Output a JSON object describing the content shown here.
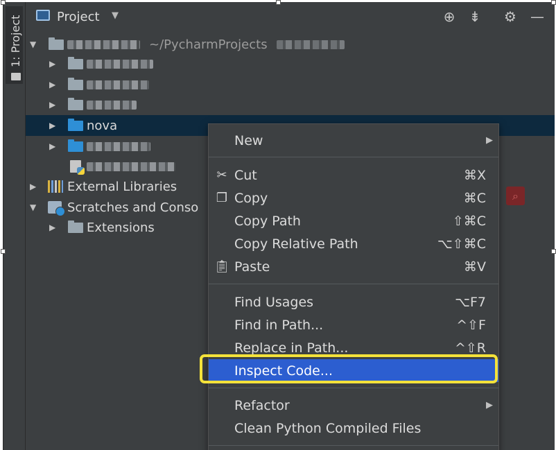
{
  "sidebar_strip": {
    "label": "1: Project",
    "icon": "folder-icon"
  },
  "header": {
    "title": "Project",
    "icons": [
      "crosshair-icon",
      "collapse-icon",
      "gear-icon",
      "minimize-icon"
    ]
  },
  "tree": {
    "root_path": "~/PycharmProjects",
    "items": [
      {
        "label": "nova",
        "icon": "folder-icon",
        "selected": true
      },
      {
        "label": "External Libraries",
        "icon": "library-icon"
      },
      {
        "label": "Scratches and Conso",
        "icon": "scratch-icon"
      },
      {
        "label": "Extensions",
        "icon": "folder-icon"
      }
    ]
  },
  "context_menu": {
    "new": {
      "label": "New"
    },
    "cut": {
      "label": "Cut",
      "shortcut": "⌘X",
      "icon": "scissors-icon"
    },
    "copy": {
      "label": "Copy",
      "shortcut": "⌘C",
      "icon": "copy-icon"
    },
    "copy_path": {
      "label": "Copy Path",
      "shortcut": "⇧⌘C"
    },
    "copy_relative_path": {
      "label": "Copy Relative Path",
      "shortcut": "⌥⇧⌘C"
    },
    "paste": {
      "label": "Paste",
      "shortcut": "⌘V",
      "icon": "clipboard-icon"
    },
    "find_usages": {
      "label": "Find Usages",
      "shortcut": "⌥F7"
    },
    "find_in_path": {
      "label": "Find in Path...",
      "shortcut": "^⇧F"
    },
    "replace_in_path": {
      "label": "Replace in Path...",
      "shortcut": "^⇧R"
    },
    "inspect_code": {
      "label": "Inspect Code...",
      "highlighted": true
    },
    "refactor": {
      "label": "Refactor"
    },
    "clean_python": {
      "label": "Clean Python Compiled Files"
    }
  },
  "colors": {
    "background": "#3c3f41",
    "selection": "#0d293e",
    "menu_highlight": "#2c5ed0",
    "callout": "#f4e23a",
    "folder_blue": "#2e8fd6"
  }
}
